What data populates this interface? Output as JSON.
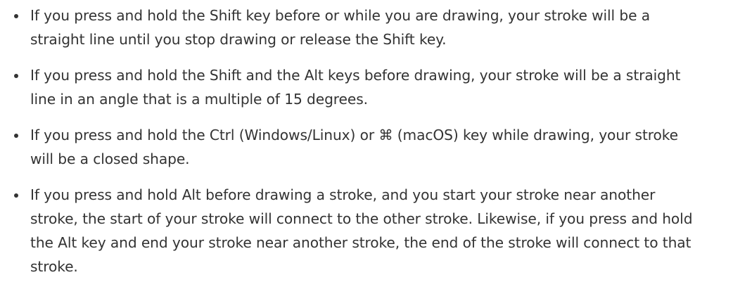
{
  "tips": [
    "If you press and hold the Shift key before or while you are drawing, your stroke will be a straight line until you stop drawing or release the Shift key.",
    "If you press and hold the Shift and the Alt keys before drawing, your stroke will be a straight line in an angle that is a multiple of 15 degrees.",
    "If you press and hold the Ctrl (Windows/Linux) or ⌘ (macOS) key while drawing, your stroke will be a closed shape.",
    "If you press and hold Alt before drawing a stroke, and you start your stroke near another stroke, the start of your stroke will connect to the other stroke. Likewise, if you press and hold the Alt key and end your stroke near another stroke, the end of the stroke will connect to that stroke."
  ]
}
